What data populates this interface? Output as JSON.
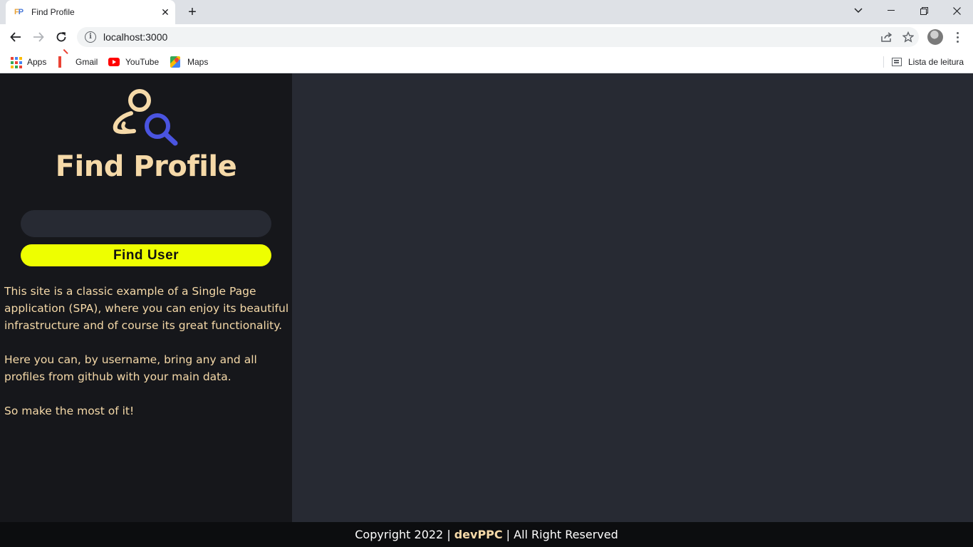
{
  "browser": {
    "tab": {
      "favicon": "FP",
      "title": "Find Profile"
    },
    "new_tab_symbol": "+",
    "url": "localhost:3000",
    "bookmarks": [
      {
        "label": "Apps",
        "icon": "apps-grid-icon"
      },
      {
        "label": "Gmail",
        "icon": "gmail-icon"
      },
      {
        "label": "YouTube",
        "icon": "youtube-icon"
      },
      {
        "label": "Maps",
        "icon": "maps-icon"
      }
    ],
    "reading_list": "Lista de leitura"
  },
  "app": {
    "title": "Find Profile",
    "logo_icon": "user-search-icon",
    "colors": {
      "accent": "#f5d9a8",
      "button": "#eeff00",
      "sidebar": "#16171b",
      "main": "#272a33",
      "magnifier": "#4a54e0"
    },
    "search": {
      "value": "",
      "placeholder": ""
    },
    "find_button": "Find User",
    "description": [
      "This site is a classic example of a Single Page application (SPA), where you can enjoy its beautiful infrastructure and of course its great functionality.",
      "Here you can, by username, bring any and all profiles from github with your main data.",
      "So make the most of it!"
    ]
  },
  "footer": {
    "prefix": "Copyright 2022 |",
    "brand": "devPPC",
    "suffix": "| All Right Reserved"
  }
}
